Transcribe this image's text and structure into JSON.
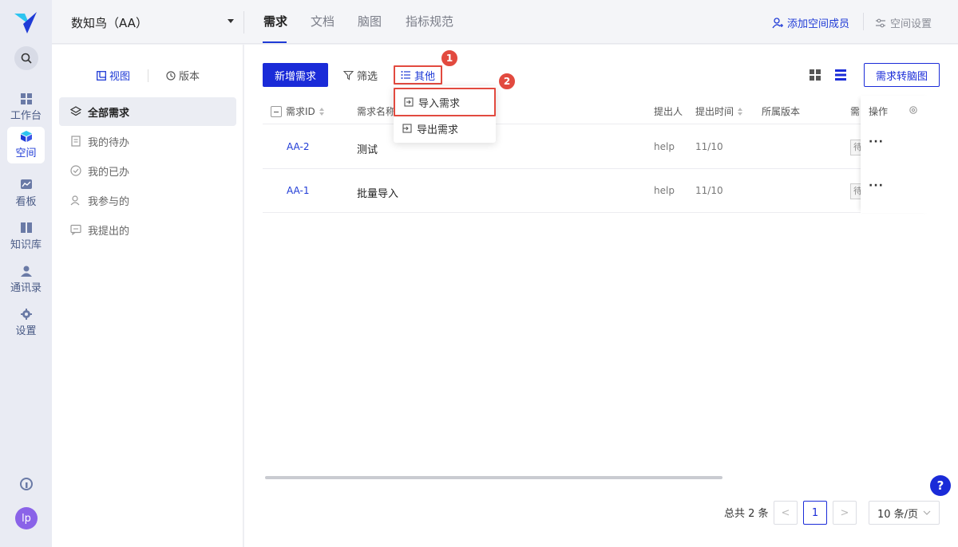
{
  "rail": {
    "items": [
      {
        "label": "工作台",
        "icon": "dashboard-icon"
      },
      {
        "label": "空间",
        "icon": "cube-icon"
      },
      {
        "label": "看板",
        "icon": "chart-icon"
      },
      {
        "label": "知识库",
        "icon": "book-icon"
      },
      {
        "label": "通讯录",
        "icon": "contacts-icon"
      },
      {
        "label": "设置",
        "icon": "gear-icon"
      }
    ],
    "avatar": "lp",
    "accent": "#1f3bd6"
  },
  "topbar": {
    "workspace": "数知鸟（AA）",
    "tabs": [
      "需求",
      "文档",
      "脑图",
      "指标规范"
    ],
    "add_member": "添加空间成员",
    "space_settings": "空间设置"
  },
  "sidebar": {
    "view_label": "视图",
    "version_label": "版本",
    "items": [
      "全部需求",
      "我的待办",
      "我的已办",
      "我参与的",
      "我提出的"
    ]
  },
  "toolbar": {
    "new_label": "新增需求",
    "filter_label": "筛选",
    "other_label": "其他",
    "mindmap_label": "需求转脑图"
  },
  "dropdown": {
    "items": [
      "导入需求",
      "导出需求"
    ]
  },
  "annotations": {
    "step1": "1",
    "step2": "2",
    "color": "#e24a3f"
  },
  "table": {
    "headers": [
      "需求ID",
      "需求名称",
      "提出人",
      "提出时间",
      "所属版本",
      "需",
      "操作"
    ],
    "rows": [
      {
        "id": "AA-2",
        "name": "测试",
        "who": "help",
        "time": "11/10",
        "status": "待",
        "ops": "···"
      },
      {
        "id": "AA-1",
        "name": "批量导入",
        "who": "help",
        "time": "11/10",
        "status": "待",
        "ops": "···"
      }
    ]
  },
  "pagination": {
    "total": "总共 2 条",
    "prev": "<",
    "current": "1",
    "next": ">",
    "page_size": "10 条/页"
  },
  "help": "?"
}
